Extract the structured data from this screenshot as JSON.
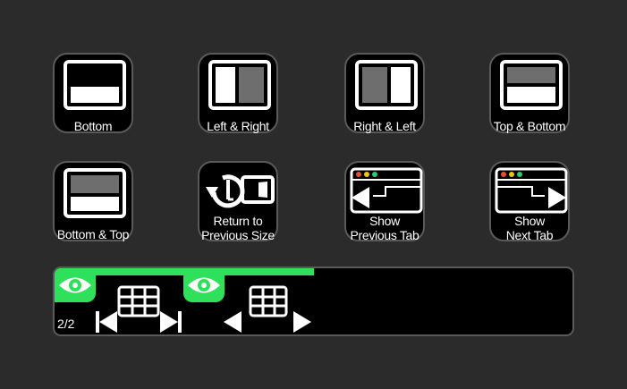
{
  "buttons": {
    "bottom": {
      "label": "Bottom"
    },
    "left_right": {
      "label": "Left & Right"
    },
    "right_left": {
      "label": "Right & Left"
    },
    "top_bottom": {
      "label": "Top & Bottom"
    },
    "bottom_top": {
      "label": "Bottom & Top"
    },
    "return_prev": {
      "label_line1": "Return to",
      "label_line2": "Previous Size"
    },
    "show_prev_tab": {
      "label_line1": "Show",
      "label_line2": "Previous Tab"
    },
    "show_next_tab": {
      "label_line1": "Show",
      "label_line2": "Next Tab"
    }
  },
  "strip": {
    "page_indicator": "2/2",
    "progress_fraction": 0.5
  },
  "colors": {
    "background": "#2b2b2b",
    "accent_green": "#2ee05a",
    "window_dot_red": "#e74c3c",
    "window_dot_yellow": "#f1c40f",
    "window_dot_green": "#2ecc71"
  },
  "icons": [
    "eye-icon",
    "grid-icon",
    "first-last-arrows-icon",
    "prev-next-arrows-icon"
  ]
}
